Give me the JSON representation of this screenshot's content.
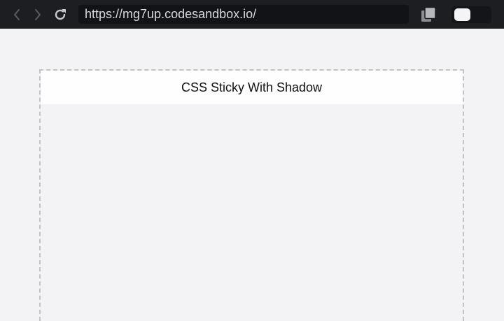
{
  "browser": {
    "url": "https://mg7up.codesandbox.io/",
    "icons": {
      "back": "chevron-left-icon",
      "forward": "chevron-right-icon",
      "reload": "reload-icon",
      "copy": "copy-icon"
    },
    "toggle_on": false
  },
  "page": {
    "header_title": "CSS Sticky With Shadow"
  },
  "colors": {
    "toolbar_bg": "#1d1e21",
    "page_bg": "#f3f2f4",
    "header_bg": "#fefefe",
    "dashed_border": "#c3c3c6"
  }
}
